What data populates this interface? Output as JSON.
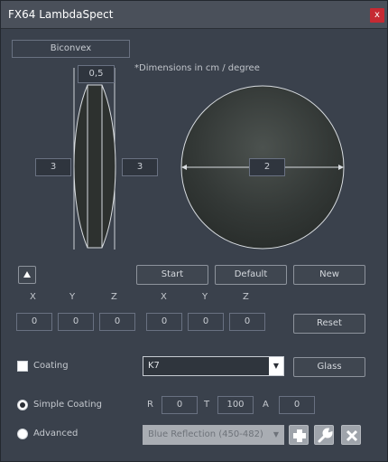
{
  "window": {
    "title": "FX64 LambdaSpect",
    "close_label": "x"
  },
  "lens": {
    "name_value": "Biconvex",
    "thickness": "0,5",
    "left_radius": "3",
    "right_radius": "3",
    "diameter": "2",
    "note": "*Dimensions in cm / degree"
  },
  "buttons": {
    "start": "Start",
    "default": "Default",
    "new": "New",
    "reset": "Reset",
    "glass": "Glass"
  },
  "axes": {
    "headers": [
      "X",
      "Y",
      "Z",
      "X",
      "Y",
      "Z"
    ],
    "values": [
      "0",
      "0",
      "0",
      "0",
      "0",
      "0"
    ]
  },
  "coating": {
    "label": "Coating",
    "glass_selected": "K7",
    "simple_label": "Simple Coating",
    "r_label": "R",
    "r_value": "0",
    "t_label": "T",
    "t_value": "100",
    "a_label": "A",
    "a_value": "0",
    "advanced_label": "Advanced",
    "advanced_selected": "Blue Reflection (450-482)"
  },
  "colors": {
    "background": "#3a414c",
    "close": "#c62a33",
    "lens_fill": "#2b2f2d",
    "outline": "#d8dce0"
  }
}
